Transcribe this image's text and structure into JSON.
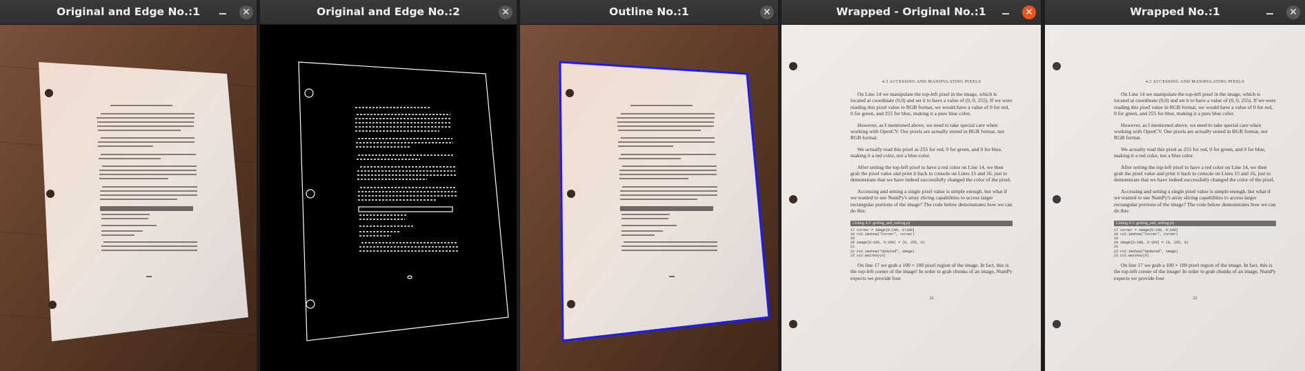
{
  "windows": [
    {
      "title": "Original and Edge No.:1",
      "close_glyph": "✕",
      "minimize_icon": "minimize-icon"
    },
    {
      "title": "Original and Edge No.:2",
      "close_glyph": "✕",
      "minimize_icon": "minimize-icon"
    },
    {
      "title": "Outline No.:1",
      "close_glyph": "✕",
      "minimize_icon": "minimize-icon"
    },
    {
      "title": "Wrapped - Original No.:1",
      "close_glyph": "✕",
      "minimize_icon": "minimize-icon"
    },
    {
      "title": "Wrapped No.:1",
      "close_glyph": "✕",
      "minimize_icon": "minimize-icon"
    }
  ],
  "document": {
    "header": "4.3 ACCESSING AND MANIPULATING PIXELS",
    "listing_caption": "Listing 4.3: getting_and_setting.py",
    "page_number": "22",
    "paragraphs": [
      "On Line 14 we manipulate the top-left pixel in the image, which is located at coordinate (0,0) and set it to have a value of (0, 0, 255). If we were reading this pixel value in RGB format, we would have a value of 0 for red, 0 for green, and 255 for blue, making it a pure blue color.",
      "However, as I mentioned above, we need to take special care when working with OpenCV. Our pixels are actually stored in BGR format, not RGB format.",
      "We actually read this pixel as 255 for red, 0 for green, and 0 for blue, making it a red color, not a blue color.",
      "After setting the top-left pixel to have a red color on Line 14, we then grab the pixel value and print it back to console on Lines 15 and 16, just to demonstrate that we have indeed successfully changed the color of the pixel.",
      "Accessing and setting a single pixel value is simple enough, but what if we wanted to use NumPy's array slicing capabilities to access larger rectangular portions of the image? The code below demonstrates how we can do this:"
    ],
    "code": [
      "17 corner = image[0:100, 0:100]",
      "18 cv2.imshow(\"Corner\", corner)",
      "19",
      "20 image[0:100, 0:100] = (0, 255, 0)",
      "21",
      "22 cv2.imshow(\"Updated\", image)",
      "23 cv2.waitKey(0)"
    ],
    "closing": "On line 17 we grab a 100 × 100 pixel region of the image. In fact, this is the top-left corner of the image! In order to grab chunks of an image, NumPy expects we provide four"
  },
  "colors": {
    "titlebar": "#333333",
    "close_active": "#e95420",
    "outline": "#1b1bff",
    "paper": "#efe9e4",
    "table": "#5a3a28"
  }
}
